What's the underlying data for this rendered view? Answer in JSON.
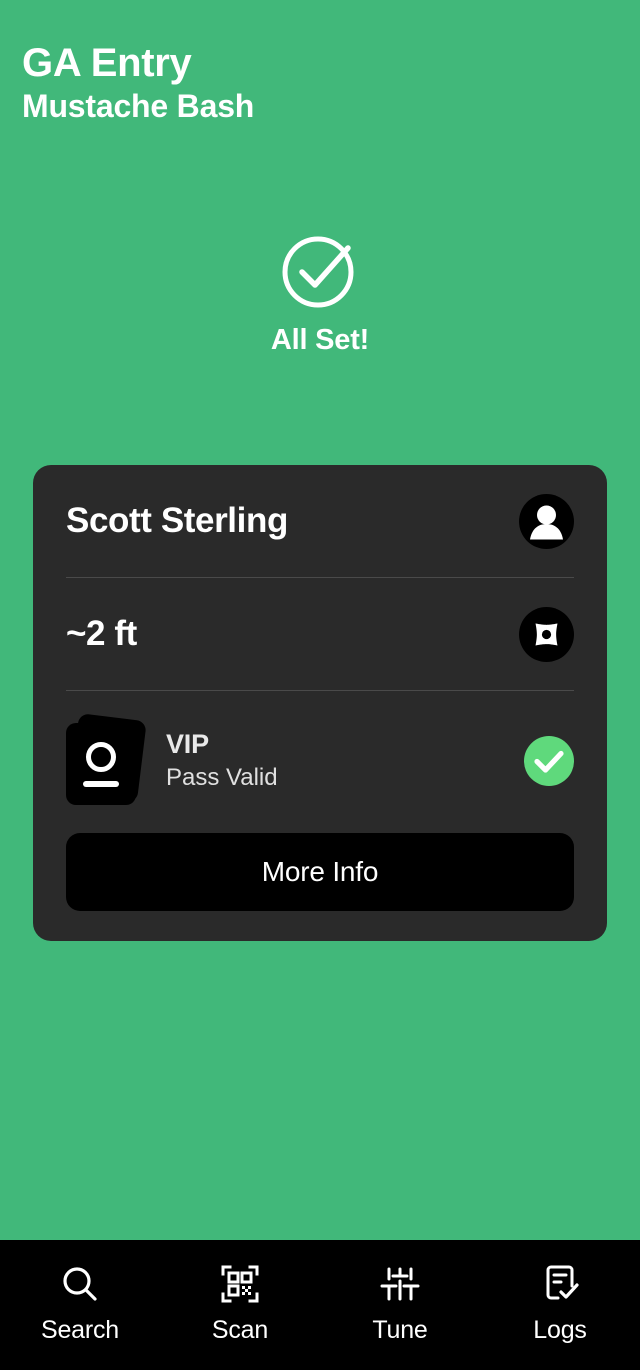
{
  "header": {
    "title": "GA Entry",
    "subtitle": "Mustache Bash"
  },
  "status": {
    "icon": "check-circle-icon",
    "label": "All Set!"
  },
  "card": {
    "person": {
      "name": "Scott Sterling",
      "icon": "person-avatar-icon"
    },
    "distance": {
      "value": "~2 ft",
      "icon": "compass-icon"
    },
    "pass": {
      "icon": "pass-card-icon",
      "tier": "VIP",
      "state": "Pass Valid",
      "status_icon": "green-check-icon",
      "status_color": "#5fd97c"
    },
    "more_info_label": "More Info"
  },
  "bottom_nav": {
    "items": [
      {
        "label": "Search",
        "icon": "search-icon"
      },
      {
        "label": "Scan",
        "icon": "qr-scan-icon"
      },
      {
        "label": "Tune",
        "icon": "tune-sliders-icon"
      },
      {
        "label": "Logs",
        "icon": "logs-document-check-icon"
      }
    ]
  },
  "theme": {
    "background": "#41b87a",
    "card_background": "#2a2a2a",
    "accent": "#5fd97c",
    "black": "#000000"
  }
}
